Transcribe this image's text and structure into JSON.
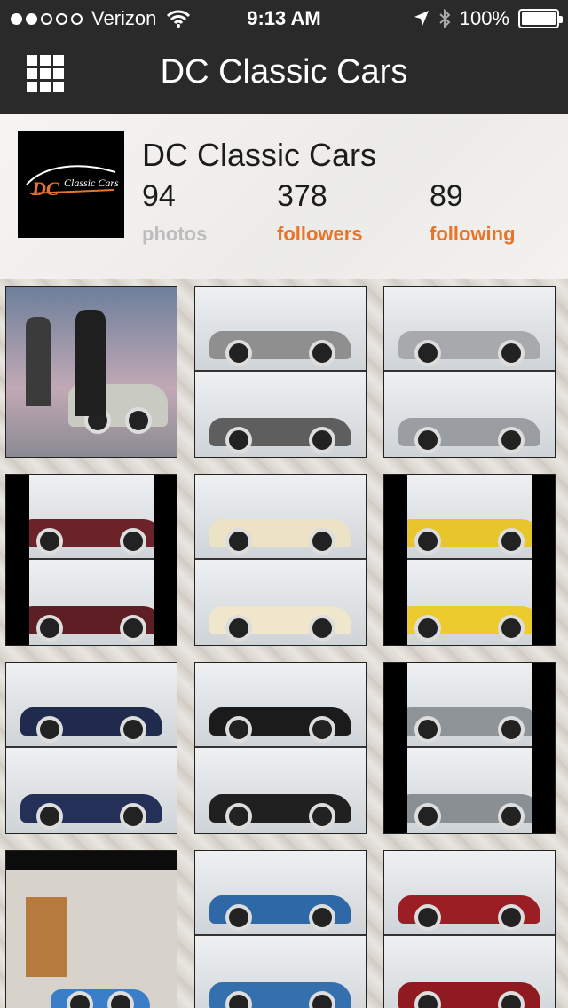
{
  "status_bar": {
    "carrier": "Verizon",
    "time": "9:13 AM",
    "battery": "100%",
    "signal_dots_filled": 2,
    "signal_dots_total": 5
  },
  "nav": {
    "title": "DC Classic Cars",
    "menu_icon": "grid-menu-icon"
  },
  "profile": {
    "name": "DC Classic Cars",
    "logo_text": "DC Classic Cars",
    "stats": [
      {
        "value": "94",
        "label": "photos",
        "color": "#bdbdbd"
      },
      {
        "value": "378",
        "label": "followers",
        "color": "#e8742a"
      },
      {
        "value": "89",
        "label": "following",
        "color": "#e8742a"
      }
    ]
  },
  "photos": [
    {
      "subject": "car show crowd",
      "car_color": "#c9cbc3"
    },
    {
      "subject": "classic sedan gray",
      "car_color": "#8f8f8f"
    },
    {
      "subject": "silver hot rod",
      "car_color": "#a7a9ad"
    },
    {
      "subject": "maroon coupe",
      "car_color": "#6b2228"
    },
    {
      "subject": "cream pickup truck",
      "car_color": "#ece3c6"
    },
    {
      "subject": "yellow sedan",
      "car_color": "#e8c62b"
    },
    {
      "subject": "blue mustang",
      "car_color": "#1f2a4d"
    },
    {
      "subject": "black hot rod coupe",
      "car_color": "#1b1b1b"
    },
    {
      "subject": "gray beetle",
      "car_color": "#8f9498"
    },
    {
      "subject": "motorcycle in garage",
      "car_color": "#3a7ec9"
    },
    {
      "subject": "blue ford truck",
      "car_color": "#2f68a6"
    },
    {
      "subject": "red custom coupe",
      "car_color": "#9b1e24"
    }
  ]
}
